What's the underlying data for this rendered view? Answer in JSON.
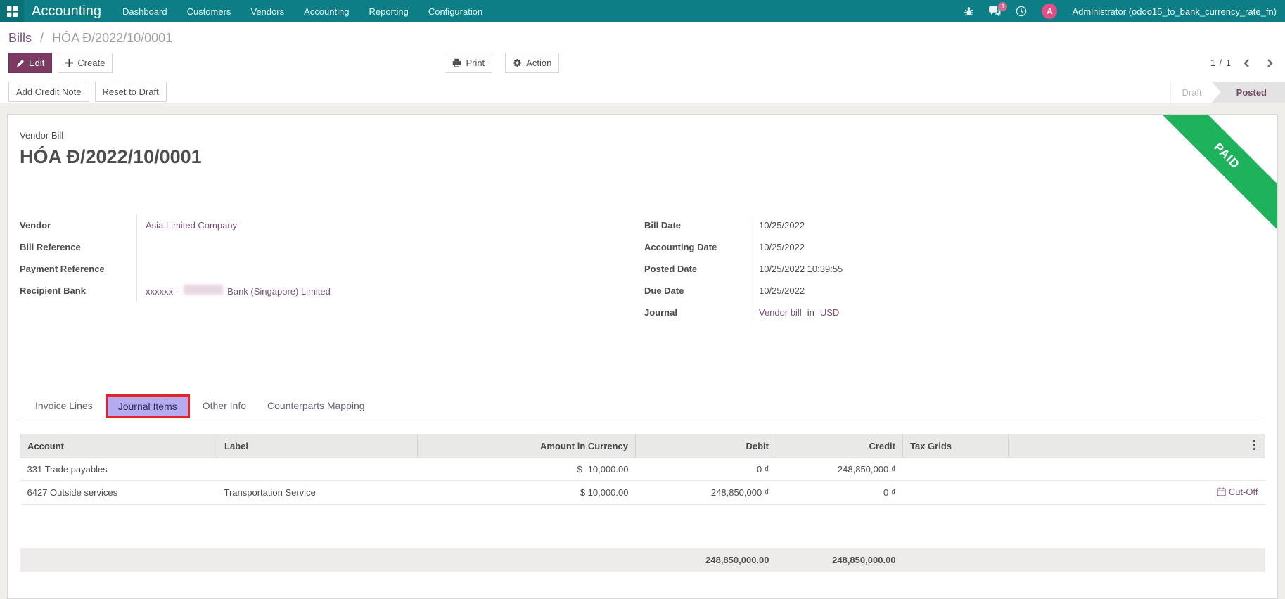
{
  "navbar": {
    "brand": "Accounting",
    "menus": [
      "Dashboard",
      "Customers",
      "Vendors",
      "Accounting",
      "Reporting",
      "Configuration"
    ],
    "message_badge": "1",
    "avatar_letter": "A",
    "user": "Administrator (odoo15_to_bank_currency_rate_fn)"
  },
  "breadcrumb": {
    "parent": "Bills",
    "separator": "/",
    "current": "HÓA Đ/2022/10/0001"
  },
  "actions": {
    "edit": "Edit",
    "create": "Create",
    "print": "Print",
    "action": "Action",
    "pager": "1 / 1"
  },
  "statusbar": {
    "buttons": [
      "Add Credit Note",
      "Reset to Draft"
    ],
    "states": [
      {
        "label": "Draft",
        "active": false
      },
      {
        "label": "Posted",
        "active": true
      }
    ]
  },
  "document": {
    "type_label": "Vendor Bill",
    "name": "HÓA Đ/2022/10/0001",
    "ribbon": "PAID",
    "fields_left": [
      {
        "label": "Vendor",
        "value": "Asia Limited Company"
      },
      {
        "label": "Bill Reference",
        "value": ""
      },
      {
        "label": "Payment Reference",
        "value": ""
      },
      {
        "label": "Recipient Bank",
        "value_prefix": "xxxxxx - ",
        "value_suffix": " Bank (Singapore) Limited",
        "redacted": true
      }
    ],
    "fields_right": [
      {
        "label": "Bill Date",
        "value": "10/25/2022"
      },
      {
        "label": "Accounting Date",
        "value": "10/25/2022"
      },
      {
        "label": "Posted Date",
        "value": "10/25/2022 10:39:55"
      },
      {
        "label": "Due Date",
        "value": "10/25/2022"
      },
      {
        "label": "Journal",
        "value": "Vendor bill",
        "conjunction": "in",
        "currency": "USD"
      }
    ]
  },
  "tabs": [
    {
      "label": "Invoice Lines",
      "active": false
    },
    {
      "label": "Journal Items",
      "active": true,
      "annotated": true
    },
    {
      "label": "Other Info",
      "active": false
    },
    {
      "label": "Counterparts Mapping",
      "active": false
    }
  ],
  "table": {
    "columns": [
      "Account",
      "Label",
      "Amount in Currency",
      "Debit",
      "Credit",
      "Tax Grids",
      ""
    ],
    "rows": [
      {
        "account": "331 Trade payables",
        "label": "",
        "amount": "$ -10,000.00",
        "debit": "0 ₫",
        "credit": "248,850,000 ₫",
        "tax": "",
        "extra": ""
      },
      {
        "account": "6427 Outside services",
        "label": "Transportation Service",
        "amount": "$ 10,000.00",
        "debit": "248,850,000 ₫",
        "credit": "0 ₫",
        "tax": "",
        "extra": "Cut-Off"
      }
    ],
    "totals": {
      "debit": "248,850,000.00",
      "credit": "248,850,000.00"
    }
  },
  "icons": {
    "apps": "grid",
    "debug": "bug",
    "messages": "chat-bubble",
    "activities": "clock",
    "edit": "pencil",
    "create": "plus",
    "print": "printer",
    "action": "gear",
    "pager_previous": "chevron-left",
    "pager_next": "chevron-right",
    "cut_off": "calendar",
    "header_options": "kebab-vertical"
  },
  "colors": {
    "navbar_teal": "#0d7e85",
    "primary_purple": "#7c3a63",
    "link_purple": "#7a5277",
    "ribbon_green": "#1fb25c",
    "annotation_red": "#e3242a",
    "tab_highlight": "#b5abf0",
    "badge_pink": "#cf6b91",
    "avatar_pink": "#e34e87",
    "status_purple": "#714b67"
  }
}
